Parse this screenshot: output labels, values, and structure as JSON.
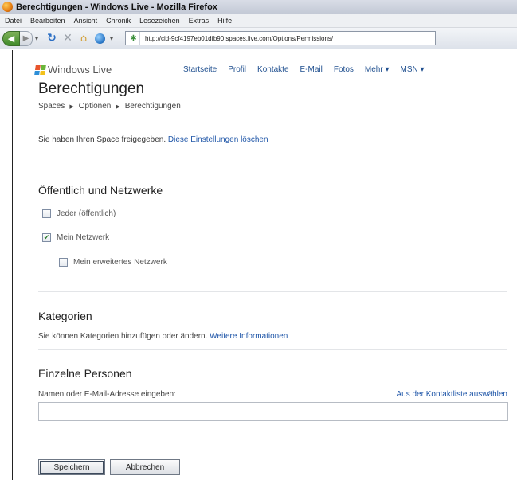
{
  "window": {
    "title": "Berechtigungen - Windows Live - Mozilla Firefox"
  },
  "menubar": {
    "items": [
      "Datei",
      "Bearbeiten",
      "Ansicht",
      "Chronik",
      "Lesezeichen",
      "Extras",
      "Hilfe"
    ]
  },
  "navbar": {
    "url": "http://cid-9cf4197eb01dfb90.spaces.live.com/Options/Permissions/"
  },
  "header": {
    "brand": "Windows Live",
    "nav": [
      "Startseite",
      "Profil",
      "Kontakte",
      "E-Mail",
      "Fotos",
      "Mehr ▾",
      "MSN ▾"
    ]
  },
  "page": {
    "title": "Berechtigungen",
    "breadcrumb": [
      "Spaces",
      "Optionen",
      "Berechtigungen"
    ],
    "share_status_text": "Sie haben Ihren Space freigegeben.",
    "share_status_link": "Diese Einstellungen löschen"
  },
  "public_section": {
    "title": "Öffentlich und Netzwerke",
    "options": [
      {
        "label": "Jeder (öffentlich)",
        "checked": false
      },
      {
        "label": "Mein Netzwerk",
        "checked": true
      },
      {
        "label": "Mein erweitertes Netzwerk",
        "checked": false
      }
    ]
  },
  "categories_section": {
    "title": "Kategorien",
    "text": "Sie können Kategorien hinzufügen oder ändern.",
    "link": "Weitere Informationen"
  },
  "persons_section": {
    "title": "Einzelne Personen",
    "input_label": "Namen oder E-Mail-Adresse eingeben:",
    "contact_link": "Aus der Kontaktliste auswählen",
    "input_value": ""
  },
  "buttons": {
    "save": "Speichern",
    "cancel": "Abbrechen"
  }
}
